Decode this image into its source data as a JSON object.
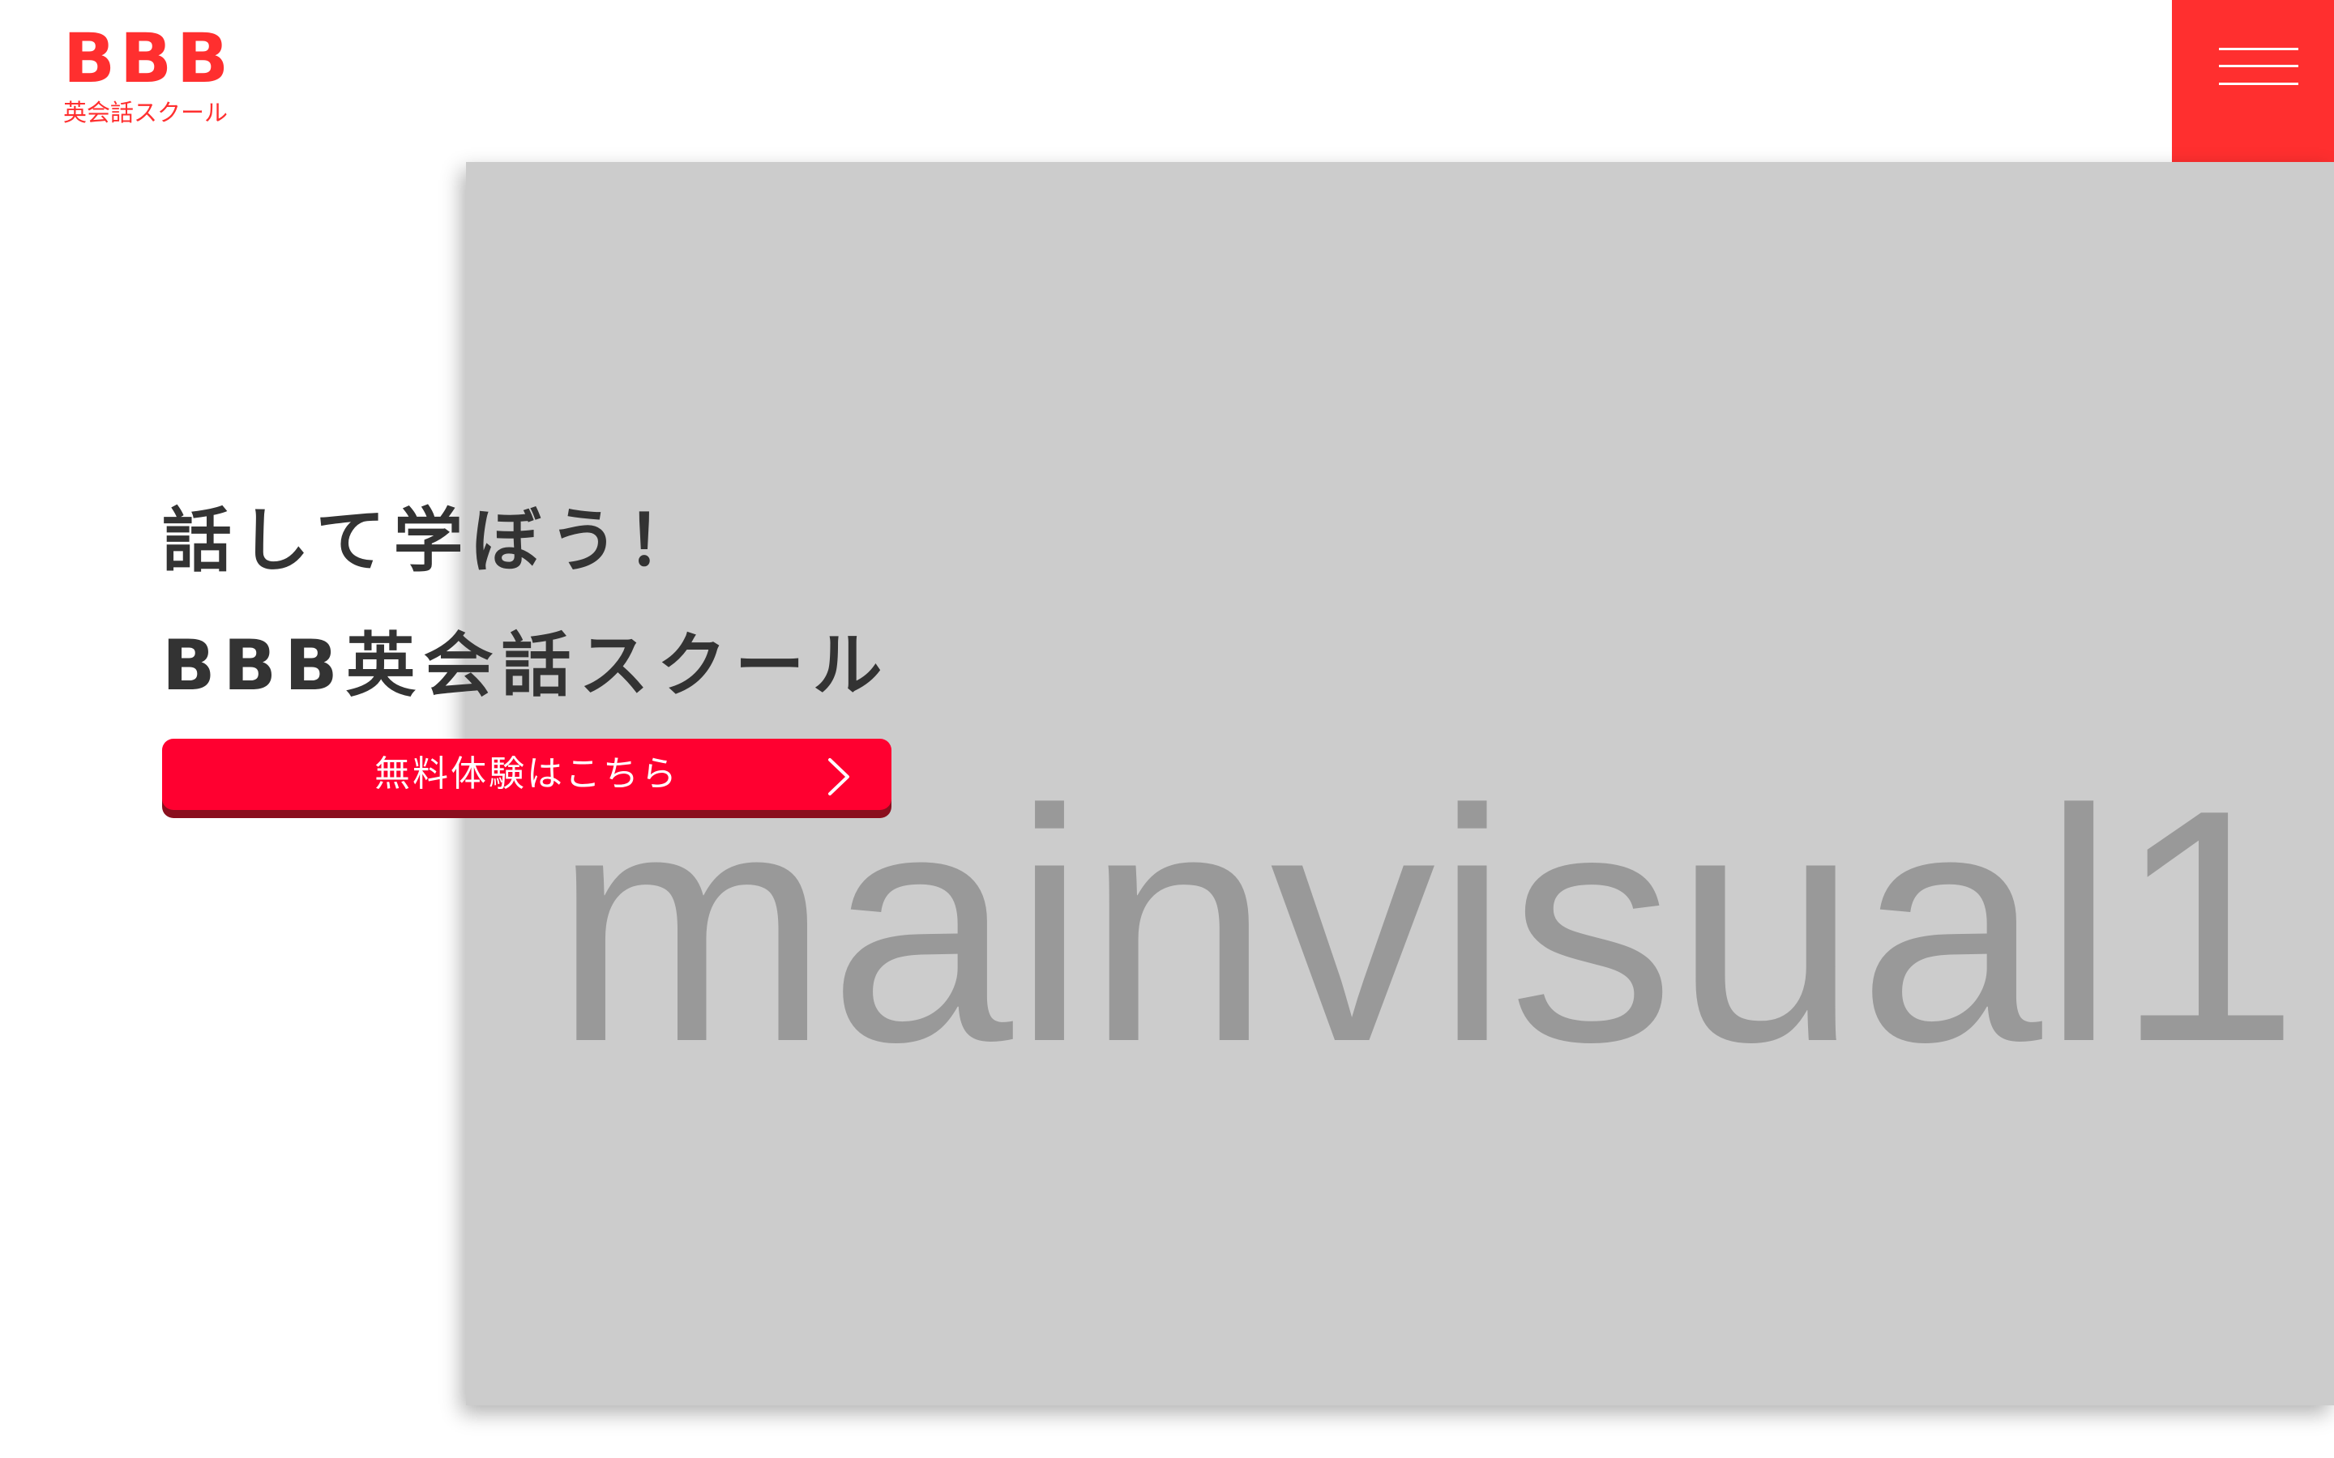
{
  "header": {
    "logo_main": "BBB",
    "logo_sub": "英会話スクール",
    "menu_icon": "hamburger-icon"
  },
  "hero": {
    "line1": "話して学ぼう！",
    "line2": "BBB英会話スクール",
    "cta_label": "無料体験はこちら",
    "cta_icon": "chevron-right-icon"
  },
  "mainvisual": {
    "placeholder_text": "mainvisual1"
  },
  "colors": {
    "brand_red": "#ff2f2f",
    "cta_red": "#ff0030",
    "cta_shadow": "#8a0f1e",
    "placeholder_bg": "#cccccc",
    "placeholder_text": "#999999",
    "heading_text": "#333333"
  }
}
